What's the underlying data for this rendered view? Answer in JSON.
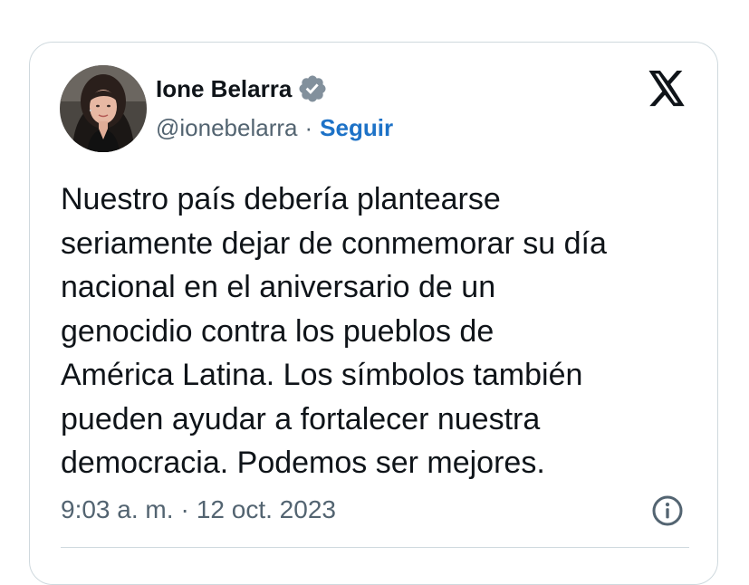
{
  "author": {
    "display_name": "Ione Belarra",
    "handle": "@ionebelarra",
    "separator": "·",
    "follow_label": "Seguir",
    "verified_badge": "verified-checkmark-icon",
    "avatar": "profile-photo"
  },
  "platform_logo": "x-logo-icon",
  "tweet": {
    "lines": [
      "Nuestro país debería plantearse",
      "seriamente dejar de conmemorar su día",
      "nacional en el aniversario de un",
      "genocidio contra los pueblos de",
      "América Latina. Los símbolos también",
      "pueden ayudar a fortalecer nuestra",
      "democracia. Podemos ser mejores."
    ]
  },
  "meta": {
    "time": "9:03 a. m.",
    "separator": "·",
    "date": "12 oct. 2023",
    "info_icon": "info-icon"
  },
  "colors": {
    "text_primary": "#0f1419",
    "text_secondary": "#536471",
    "link_blue": "#1d72c7",
    "border": "#cfd9de",
    "verified_gray": "#82909c"
  }
}
